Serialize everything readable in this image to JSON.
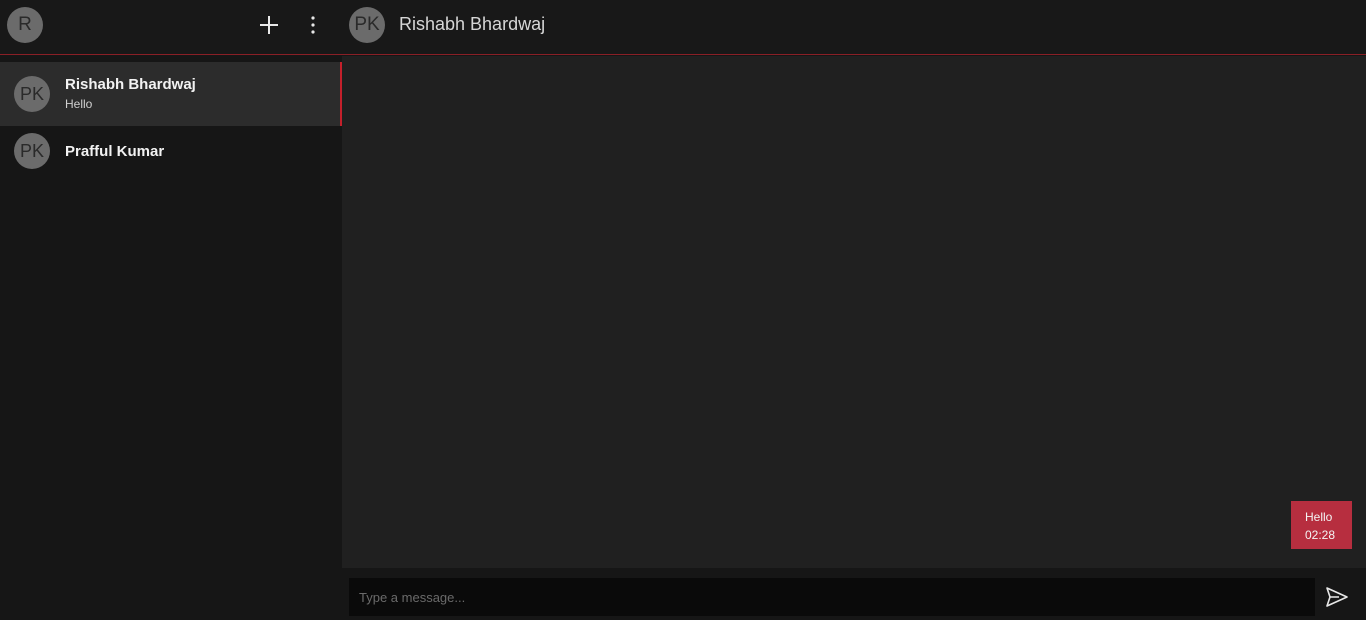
{
  "header": {
    "user_initial": "R",
    "chat_initials": "PK",
    "chat_title": "Rishabh Bhardwaj"
  },
  "contacts": [
    {
      "initials": "PK",
      "name": "Rishabh Bhardwaj",
      "preview": "Hello",
      "active": true
    },
    {
      "initials": "PK",
      "name": "Prafful Kumar",
      "preview": "",
      "active": false
    }
  ],
  "messages": [
    {
      "text": "Hello",
      "time": "02:28",
      "outgoing": true
    }
  ],
  "composer": {
    "placeholder": "Type a message..."
  },
  "icons": {
    "add": "plus-icon",
    "menu": "more-vertical-icon",
    "send": "send-icon"
  },
  "colors": {
    "accent": "#c4202b",
    "bubble": "#b72e3f",
    "avatar": "#6b6b6b"
  }
}
